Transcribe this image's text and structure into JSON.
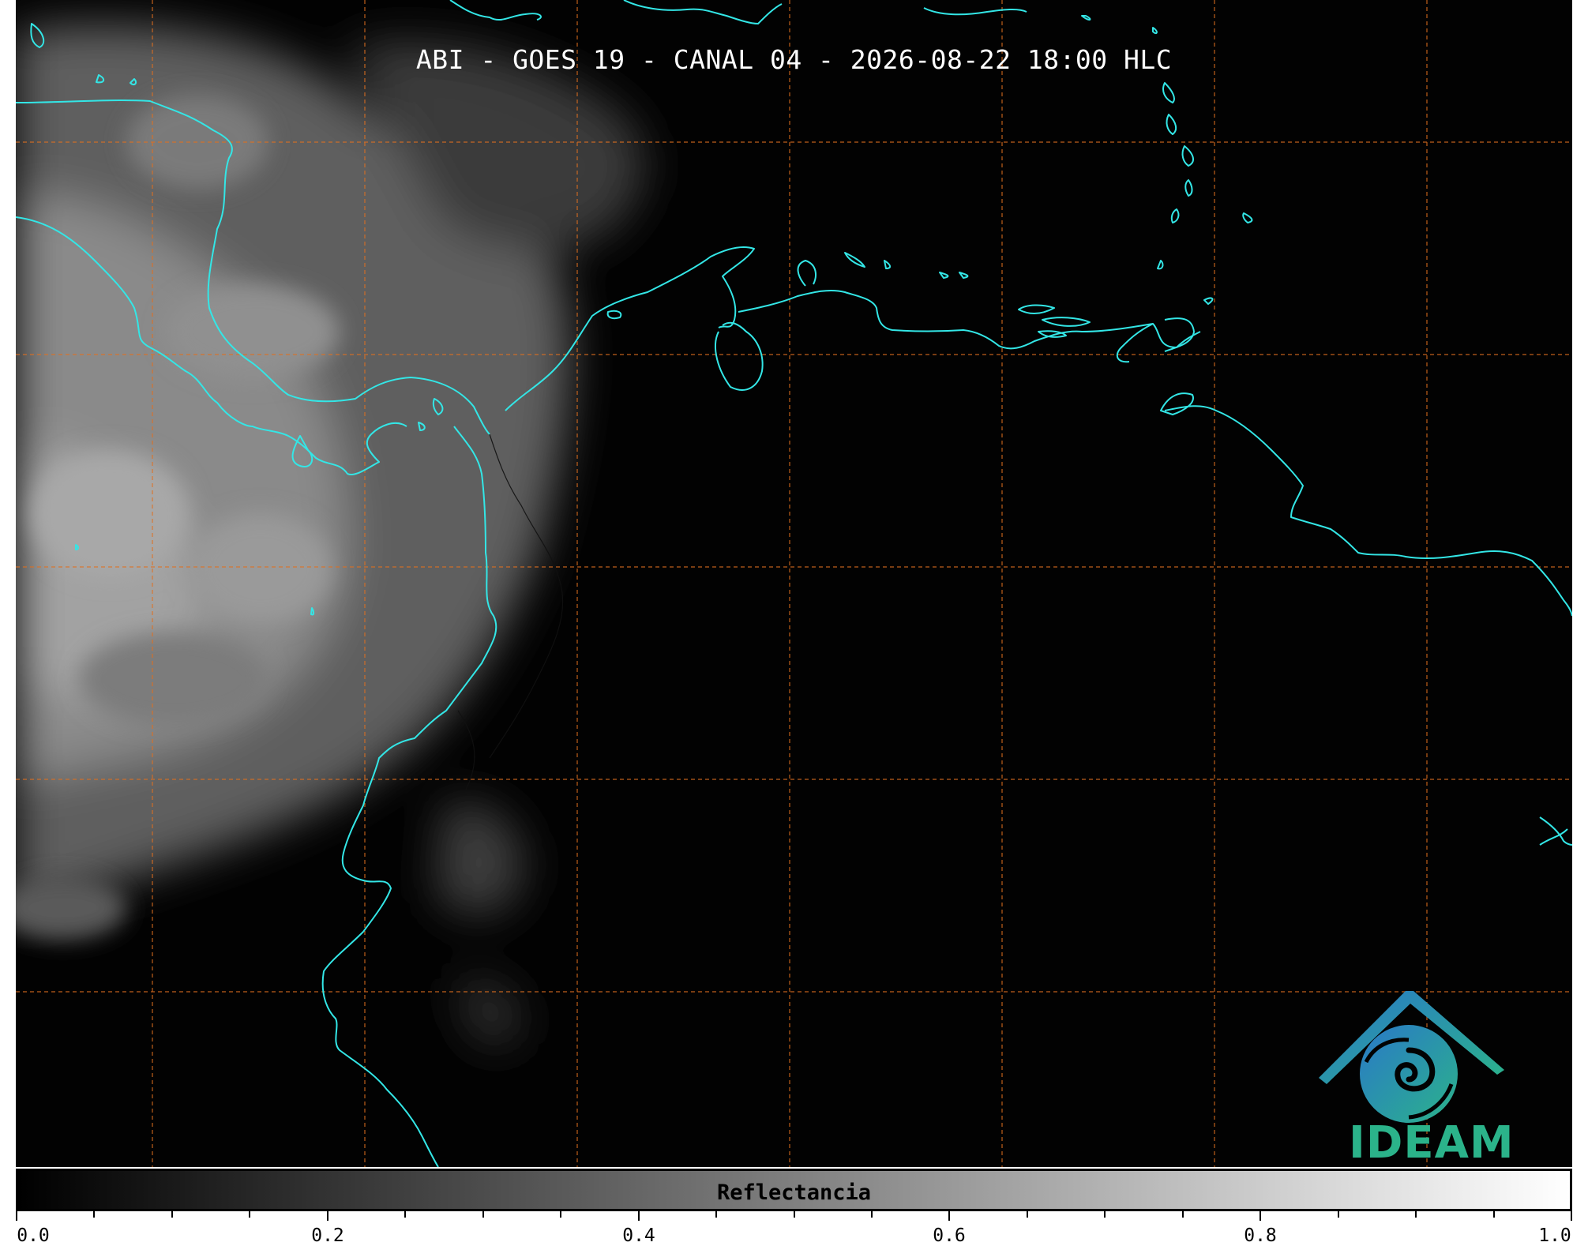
{
  "map": {
    "title": "ABI - GOES 19 - CANAL 04 - 2026-08-22 18:00 HLC",
    "coastline_color": "#33e6e6",
    "gridline_color": "#e07020",
    "background_color": "#020202",
    "cloud_color": "#9a9a9a"
  },
  "logo": {
    "text": "IDEAM",
    "text_color": "#2bb38a",
    "icon": "ideam-mountain-spiral-icon"
  },
  "colorbar": {
    "label": "Reflectancia",
    "min": 0.0,
    "max": 1.0,
    "tick_labels": [
      "0.0",
      "0.2",
      "0.4",
      "0.6",
      "0.8",
      "1.0"
    ],
    "colormap": "greys"
  }
}
